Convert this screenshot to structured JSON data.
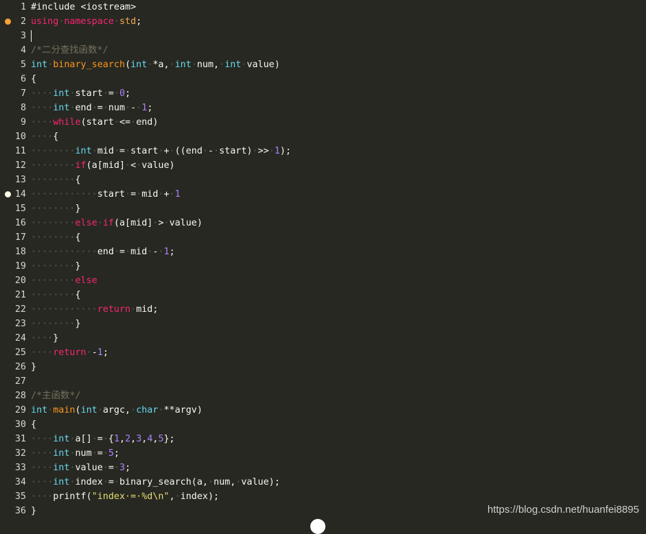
{
  "lines": [
    {
      "n": "1",
      "t": [
        [
          "#include <iostream>",
          ""
        ]
      ]
    },
    {
      "n": "2",
      "t": [
        [
          "using",
          "kw"
        ],
        [
          "·",
          ""
        ],
        [
          "namespace",
          "kw"
        ],
        [
          "·",
          ""
        ],
        [
          "std",
          "ns"
        ],
        [
          ";",
          ""
        ]
      ],
      "marker": "#f6a13a"
    },
    {
      "n": "3",
      "t": [
        [
          "",
          ""
        ]
      ],
      "cursor": true
    },
    {
      "n": "4",
      "t": [
        [
          "/*二分查找函数*/",
          "cm"
        ]
      ]
    },
    {
      "n": "5",
      "t": [
        [
          "int",
          "ty"
        ],
        [
          "·",
          ""
        ],
        [
          "binary_search",
          "fn"
        ],
        [
          "(",
          ""
        ],
        [
          "int",
          "ty"
        ],
        [
          "·",
          ""
        ],
        [
          "*a,",
          ""
        ],
        [
          "·",
          ""
        ],
        [
          "int",
          "ty"
        ],
        [
          "·",
          ""
        ],
        [
          "num,",
          ""
        ],
        [
          "·",
          ""
        ],
        [
          "int",
          "ty"
        ],
        [
          "·",
          ""
        ],
        [
          "value)",
          ""
        ]
      ]
    },
    {
      "n": "6",
      "t": [
        [
          "{",
          ""
        ]
      ]
    },
    {
      "n": "7",
      "t": [
        [
          "····",
          ""
        ],
        [
          "int",
          "ty"
        ],
        [
          "·",
          ""
        ],
        [
          "start",
          ""
        ],
        [
          "·",
          ""
        ],
        [
          "=",
          ""
        ],
        [
          "·",
          ""
        ],
        [
          "0",
          "num"
        ],
        [
          ";",
          ""
        ]
      ]
    },
    {
      "n": "8",
      "t": [
        [
          "····",
          ""
        ],
        [
          "int",
          "ty"
        ],
        [
          "·",
          ""
        ],
        [
          "end",
          ""
        ],
        [
          "·",
          ""
        ],
        [
          "=",
          ""
        ],
        [
          "·",
          ""
        ],
        [
          "num",
          ""
        ],
        [
          "·",
          ""
        ],
        [
          "-",
          ""
        ],
        [
          "·",
          ""
        ],
        [
          "1",
          "num"
        ],
        [
          ";",
          ""
        ]
      ]
    },
    {
      "n": "9",
      "t": [
        [
          "····",
          ""
        ],
        [
          "while",
          "kw"
        ],
        [
          "(start",
          ""
        ],
        [
          "·",
          ""
        ],
        [
          "<=",
          ""
        ],
        [
          "·",
          ""
        ],
        [
          "end)",
          ""
        ]
      ]
    },
    {
      "n": "10",
      "t": [
        [
          "····",
          ""
        ],
        [
          "{",
          ""
        ]
      ]
    },
    {
      "n": "11",
      "t": [
        [
          "········",
          ""
        ],
        [
          "int",
          "ty"
        ],
        [
          "·",
          ""
        ],
        [
          "mid",
          ""
        ],
        [
          "·",
          ""
        ],
        [
          "=",
          ""
        ],
        [
          "·",
          ""
        ],
        [
          "start",
          ""
        ],
        [
          "·",
          ""
        ],
        [
          "+",
          ""
        ],
        [
          "·",
          ""
        ],
        [
          "((end",
          ""
        ],
        [
          "·",
          ""
        ],
        [
          "-",
          ""
        ],
        [
          "·",
          ""
        ],
        [
          "start)",
          ""
        ],
        [
          "·",
          ""
        ],
        [
          ">>",
          ""
        ],
        [
          "·",
          ""
        ],
        [
          "1",
          "num"
        ],
        [
          ");",
          ""
        ]
      ]
    },
    {
      "n": "12",
      "t": [
        [
          "········",
          ""
        ],
        [
          "if",
          "kw"
        ],
        [
          "(a[mid]",
          ""
        ],
        [
          "·",
          ""
        ],
        [
          "<",
          ""
        ],
        [
          "·",
          ""
        ],
        [
          "value)",
          ""
        ]
      ]
    },
    {
      "n": "13",
      "t": [
        [
          "········",
          ""
        ],
        [
          "{",
          ""
        ]
      ]
    },
    {
      "n": "14",
      "t": [
        [
          "············",
          ""
        ],
        [
          "start",
          ""
        ],
        [
          "·",
          ""
        ],
        [
          "=",
          ""
        ],
        [
          "·",
          ""
        ],
        [
          "mid",
          ""
        ],
        [
          "·",
          ""
        ],
        [
          "+",
          ""
        ],
        [
          "·",
          ""
        ],
        [
          "1",
          "num"
        ]
      ],
      "marker": "#fffbe8"
    },
    {
      "n": "15",
      "t": [
        [
          "········",
          ""
        ],
        [
          "}",
          ""
        ]
      ]
    },
    {
      "n": "16",
      "t": [
        [
          "········",
          ""
        ],
        [
          "else",
          "kw"
        ],
        [
          "·",
          ""
        ],
        [
          "if",
          "kw"
        ],
        [
          "(a[mid]",
          ""
        ],
        [
          "·",
          ""
        ],
        [
          ">",
          ""
        ],
        [
          "·",
          ""
        ],
        [
          "value)",
          ""
        ]
      ]
    },
    {
      "n": "17",
      "t": [
        [
          "········",
          ""
        ],
        [
          "{",
          ""
        ]
      ]
    },
    {
      "n": "18",
      "t": [
        [
          "············",
          ""
        ],
        [
          "end",
          ""
        ],
        [
          "·",
          ""
        ],
        [
          "=",
          ""
        ],
        [
          "·",
          ""
        ],
        [
          "mid",
          ""
        ],
        [
          "·",
          ""
        ],
        [
          "-",
          ""
        ],
        [
          "·",
          ""
        ],
        [
          "1",
          "num"
        ],
        [
          ";",
          ""
        ]
      ]
    },
    {
      "n": "19",
      "t": [
        [
          "········",
          ""
        ],
        [
          "}",
          ""
        ]
      ]
    },
    {
      "n": "20",
      "t": [
        [
          "········",
          ""
        ],
        [
          "else",
          "kw"
        ]
      ]
    },
    {
      "n": "21",
      "t": [
        [
          "········",
          ""
        ],
        [
          "{",
          ""
        ]
      ]
    },
    {
      "n": "22",
      "t": [
        [
          "············",
          ""
        ],
        [
          "return",
          "kw"
        ],
        [
          "·",
          ""
        ],
        [
          "mid;",
          ""
        ]
      ]
    },
    {
      "n": "23",
      "t": [
        [
          "········",
          ""
        ],
        [
          "}",
          ""
        ]
      ]
    },
    {
      "n": "24",
      "t": [
        [
          "····",
          ""
        ],
        [
          "}",
          ""
        ]
      ]
    },
    {
      "n": "25",
      "t": [
        [
          "····",
          ""
        ],
        [
          "return",
          "kw"
        ],
        [
          "·",
          ""
        ],
        [
          "-",
          ""
        ],
        [
          "1",
          "num"
        ],
        [
          ";",
          ""
        ]
      ]
    },
    {
      "n": "26",
      "t": [
        [
          "}",
          ""
        ]
      ]
    },
    {
      "n": "27",
      "t": [
        [
          "",
          ""
        ]
      ]
    },
    {
      "n": "28",
      "t": [
        [
          "/*主函数*/",
          "cm"
        ]
      ]
    },
    {
      "n": "29",
      "t": [
        [
          "int",
          "ty"
        ],
        [
          "·",
          ""
        ],
        [
          "main",
          "fn"
        ],
        [
          "(",
          ""
        ],
        [
          "int",
          "ty"
        ],
        [
          "·",
          ""
        ],
        [
          "argc,",
          ""
        ],
        [
          "·",
          ""
        ],
        [
          "char",
          "ty"
        ],
        [
          "·",
          ""
        ],
        [
          "**argv)",
          ""
        ]
      ]
    },
    {
      "n": "30",
      "t": [
        [
          "{",
          ""
        ]
      ]
    },
    {
      "n": "31",
      "t": [
        [
          "····",
          ""
        ],
        [
          "int",
          "ty"
        ],
        [
          "·",
          ""
        ],
        [
          "a[]",
          ""
        ],
        [
          "·",
          ""
        ],
        [
          "=",
          ""
        ],
        [
          "·",
          ""
        ],
        [
          "{",
          ""
        ],
        [
          "1",
          "num"
        ],
        [
          ",",
          ""
        ],
        [
          "2",
          "num"
        ],
        [
          ",",
          ""
        ],
        [
          "3",
          "num"
        ],
        [
          ",",
          ""
        ],
        [
          "4",
          "num"
        ],
        [
          ",",
          ""
        ],
        [
          "5",
          "num"
        ],
        [
          "};",
          ""
        ]
      ]
    },
    {
      "n": "32",
      "t": [
        [
          "····",
          ""
        ],
        [
          "int",
          "ty"
        ],
        [
          "·",
          ""
        ],
        [
          "num",
          ""
        ],
        [
          "·",
          ""
        ],
        [
          "=",
          ""
        ],
        [
          "·",
          ""
        ],
        [
          "5",
          "num"
        ],
        [
          ";",
          ""
        ]
      ]
    },
    {
      "n": "33",
      "t": [
        [
          "····",
          ""
        ],
        [
          "int",
          "ty"
        ],
        [
          "·",
          ""
        ],
        [
          "value",
          ""
        ],
        [
          "·",
          ""
        ],
        [
          "=",
          ""
        ],
        [
          "·",
          ""
        ],
        [
          "3",
          "num"
        ],
        [
          ";",
          ""
        ]
      ]
    },
    {
      "n": "34",
      "t": [
        [
          "····",
          ""
        ],
        [
          "int",
          "ty"
        ],
        [
          "·",
          ""
        ],
        [
          "index",
          ""
        ],
        [
          "·",
          ""
        ],
        [
          "=",
          ""
        ],
        [
          "·",
          ""
        ],
        [
          "binary_search(a,",
          ""
        ],
        [
          "·",
          ""
        ],
        [
          "num,",
          ""
        ],
        [
          "·",
          ""
        ],
        [
          "value);",
          ""
        ]
      ]
    },
    {
      "n": "35",
      "t": [
        [
          "····",
          ""
        ],
        [
          "printf(",
          ""
        ],
        [
          "\"index·=·%d\\n\"",
          "str"
        ],
        [
          ",",
          ""
        ],
        [
          "·",
          ""
        ],
        [
          "index);",
          ""
        ]
      ]
    },
    {
      "n": "36",
      "t": [
        [
          "}",
          ""
        ]
      ]
    }
  ],
  "watermark": "https://blog.csdn.net/huanfei8895",
  "colors": {
    "background": "#272822",
    "keyword": "#f92672",
    "type": "#66d9ef",
    "function": "#fd971f",
    "number": "#ae81ff",
    "string": "#e6db74",
    "comment": "#75715e"
  }
}
